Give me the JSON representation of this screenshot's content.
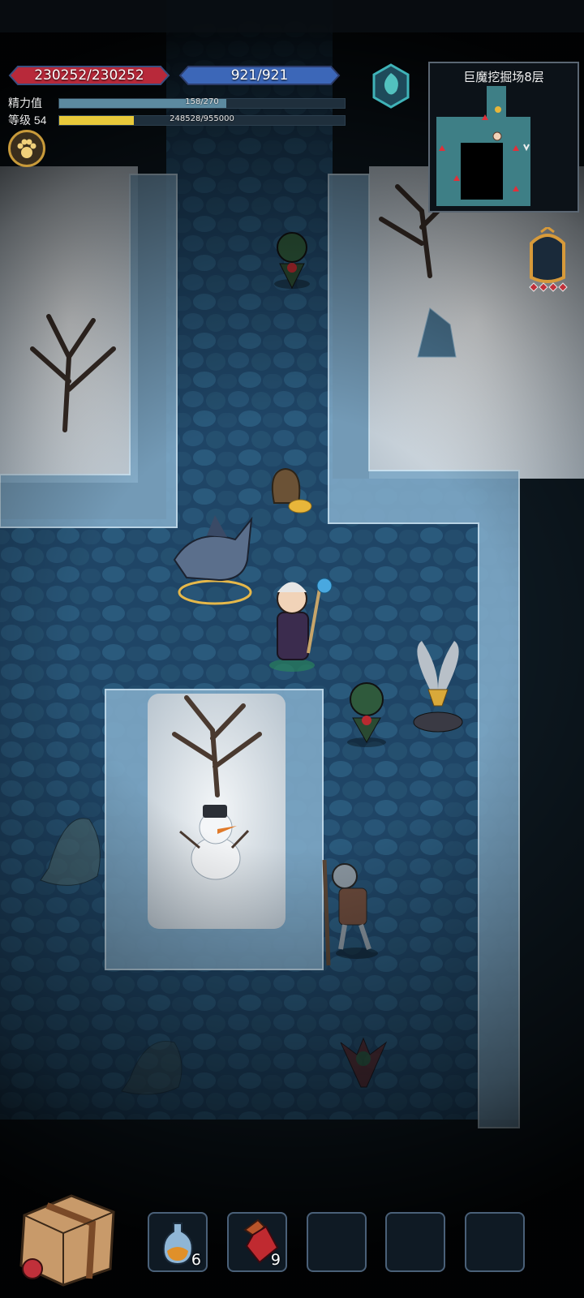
{
  "hud": {
    "hp": {
      "text": "230252/230252",
      "color": "#c0303a"
    },
    "mp": {
      "text": "921/921",
      "color": "#3d6fc0"
    },
    "energy": {
      "label": "精力值",
      "text": "158/270",
      "fraction": 0.585,
      "color": "#5c8aa0"
    },
    "level": {
      "label": "等级 54",
      "text": "248528/955000",
      "fraction": 0.26,
      "color": "#e8c93a"
    }
  },
  "minimap": {
    "title": "巨魔挖掘场8层",
    "floor_color": "#3e7f86"
  },
  "buttons": {
    "pet": {
      "icon": "paw-icon"
    },
    "portal": {
      "icon": "portal-rune-icon"
    },
    "mirror": {
      "icon": "magic-mirror-icon"
    },
    "backpack": {
      "icon": "backpack-icon"
    }
  },
  "quickbar": {
    "slots": [
      {
        "item": "blue-potion-icon",
        "count": "6"
      },
      {
        "item": "red-potion-icon",
        "count": "9"
      },
      {
        "item": "",
        "count": ""
      },
      {
        "item": "",
        "count": ""
      },
      {
        "item": "",
        "count": ""
      }
    ]
  }
}
